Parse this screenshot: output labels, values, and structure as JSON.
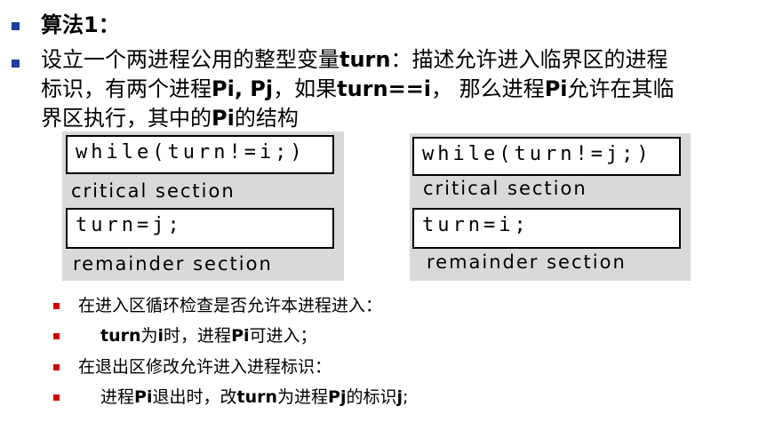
{
  "heading": {
    "algo_label": "算法1："
  },
  "paragraph": {
    "line1_pre": "设立一个两进程公用的整型变量",
    "line1_bold": "turn",
    "line1_post": "：描述允许进入临界区的进程",
    "line2_pre": "标识，有两个进程",
    "line2_bold1": "Pi, Pj",
    "line2_mid": "，如果",
    "line2_bold2": "turn==i",
    "line2_mid2": "， 那么进程",
    "line2_bold3": "Pi",
    "line2_post": "允许在其临",
    "line3_pre": "界区执行，其中的",
    "line3_bold": "Pi",
    "line3_post": "的结构"
  },
  "left_panel": {
    "while_code": "while(turn!=i;)",
    "critical_label": "critical section",
    "assign_code": "turn=j;",
    "remainder_label": "remainder section"
  },
  "right_panel": {
    "while_code": "while(turn!=j;)",
    "critical_label": "critical section",
    "assign_code": "turn=i;",
    "remainder_label": "remainder section"
  },
  "sub_bullets": {
    "item1": "在进入区循环检查是否允许本进程进入：",
    "item2_bold1": "turn",
    "item2_mid": "为",
    "item2_bold2": "i",
    "item2_mid2": "时，进程",
    "item2_bold3": "Pi",
    "item2_post": "可进入；",
    "item3": "在退出区修改允许进入进程标识：",
    "item4_pre": "进程",
    "item4_bold1": "Pi",
    "item4_mid": "退出时，改",
    "item4_bold2": "turn",
    "item4_mid2": "为进程",
    "item4_bold3": "Pj",
    "item4_mid3": "的标识",
    "item4_bold4": "j",
    "item4_post": ";"
  },
  "colors": {
    "main_bullet": "#1f3fa0",
    "sub_bullet": "#d40000",
    "panel_bg": "#d9d9d9"
  }
}
